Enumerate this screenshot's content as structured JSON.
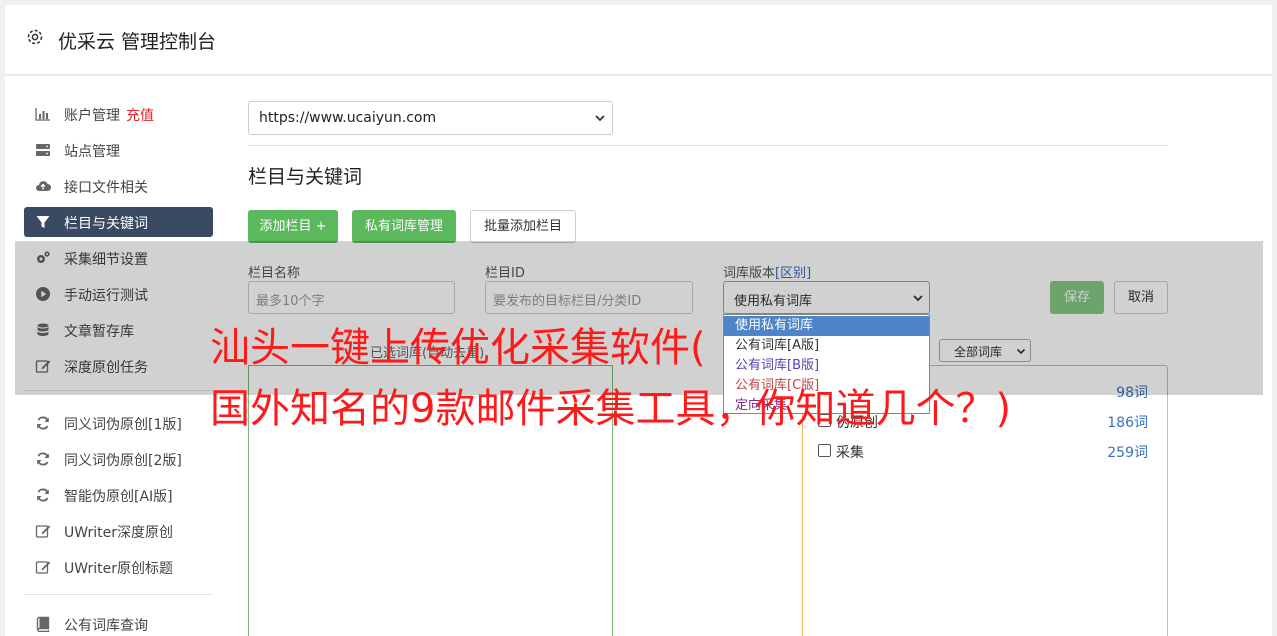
{
  "header": {
    "title": "优采云 管理控制台"
  },
  "sidebar": {
    "items": [
      {
        "label": "账户管理",
        "badge": "充值"
      },
      {
        "label": "站点管理"
      },
      {
        "label": "接口文件相关"
      },
      {
        "label": "栏目与关键词"
      },
      {
        "label": "采集细节设置"
      },
      {
        "label": "手动运行测试"
      },
      {
        "label": "文章暂存库"
      },
      {
        "label": "深度原创任务"
      },
      {
        "label": "同义词伪原创[1版]"
      },
      {
        "label": "同义词伪原创[2版]"
      },
      {
        "label": "智能伪原创[AI版]"
      },
      {
        "label": "UWriter深度原创"
      },
      {
        "label": "UWriter原创标题"
      },
      {
        "label": "公有词库查询"
      }
    ]
  },
  "site_select": {
    "value": "https://www.ucaiyun.com"
  },
  "section": {
    "title": "栏目与关键词"
  },
  "toolbar": {
    "add_column": "添加栏目 +",
    "private_library": "私有词库管理",
    "batch_add": "批量添加栏目"
  },
  "form": {
    "column_name": {
      "label": "栏目名称",
      "placeholder": "最多10个字"
    },
    "column_id": {
      "label": "栏目ID",
      "placeholder": "要发布的目标栏目/分类ID"
    },
    "library_version": {
      "label": "词库版本",
      "label_link": "[区别]",
      "value": "使用私有词库"
    },
    "save": "保存",
    "cancel": "取消"
  },
  "dropdown": {
    "options": [
      "使用私有词库",
      "公有词库[A版]",
      "公有词库[B版]",
      "公有词库[C版]",
      "定向采集"
    ]
  },
  "library": {
    "selected_hint": "已选词库(自动去重)",
    "filter": "全部词库",
    "keywords": [
      {
        "name": "",
        "count": "98词"
      },
      {
        "name": "伪原创",
        "count": "186词"
      },
      {
        "name": "采集",
        "count": "259词"
      }
    ]
  },
  "watermark": {
    "line1": "汕头一键上传优化采集软件(",
    "line2": "国外知名的9款邮件采集工具，你知道几个？)"
  }
}
